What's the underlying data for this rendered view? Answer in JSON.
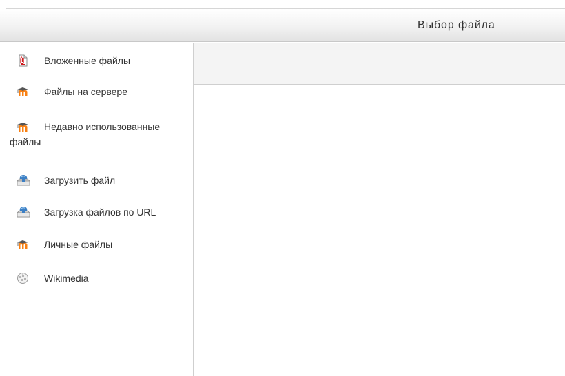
{
  "header": {
    "title": "Выбор файла"
  },
  "sidebar": {
    "items": [
      {
        "label": "Вложенные файлы",
        "icon": "attachment-file-icon"
      },
      {
        "label": "Файлы на сервере",
        "icon": "moodle-icon"
      },
      {
        "label_line1": "Недавно использованные",
        "label_line2": "файлы",
        "icon": "moodle-icon"
      },
      {
        "label": "Загрузить файл",
        "icon": "upload-icon"
      },
      {
        "label": "Загрузка файлов по URL",
        "icon": "upload-icon"
      },
      {
        "label": "Личные файлы",
        "icon": "moodle-icon"
      },
      {
        "label": "Wikimedia",
        "icon": "wikimedia-icon"
      }
    ]
  },
  "colors": {
    "moodle_orange": "#f98012",
    "moodle_gray": "#555555",
    "upload_blue": "#3c7fc4"
  }
}
